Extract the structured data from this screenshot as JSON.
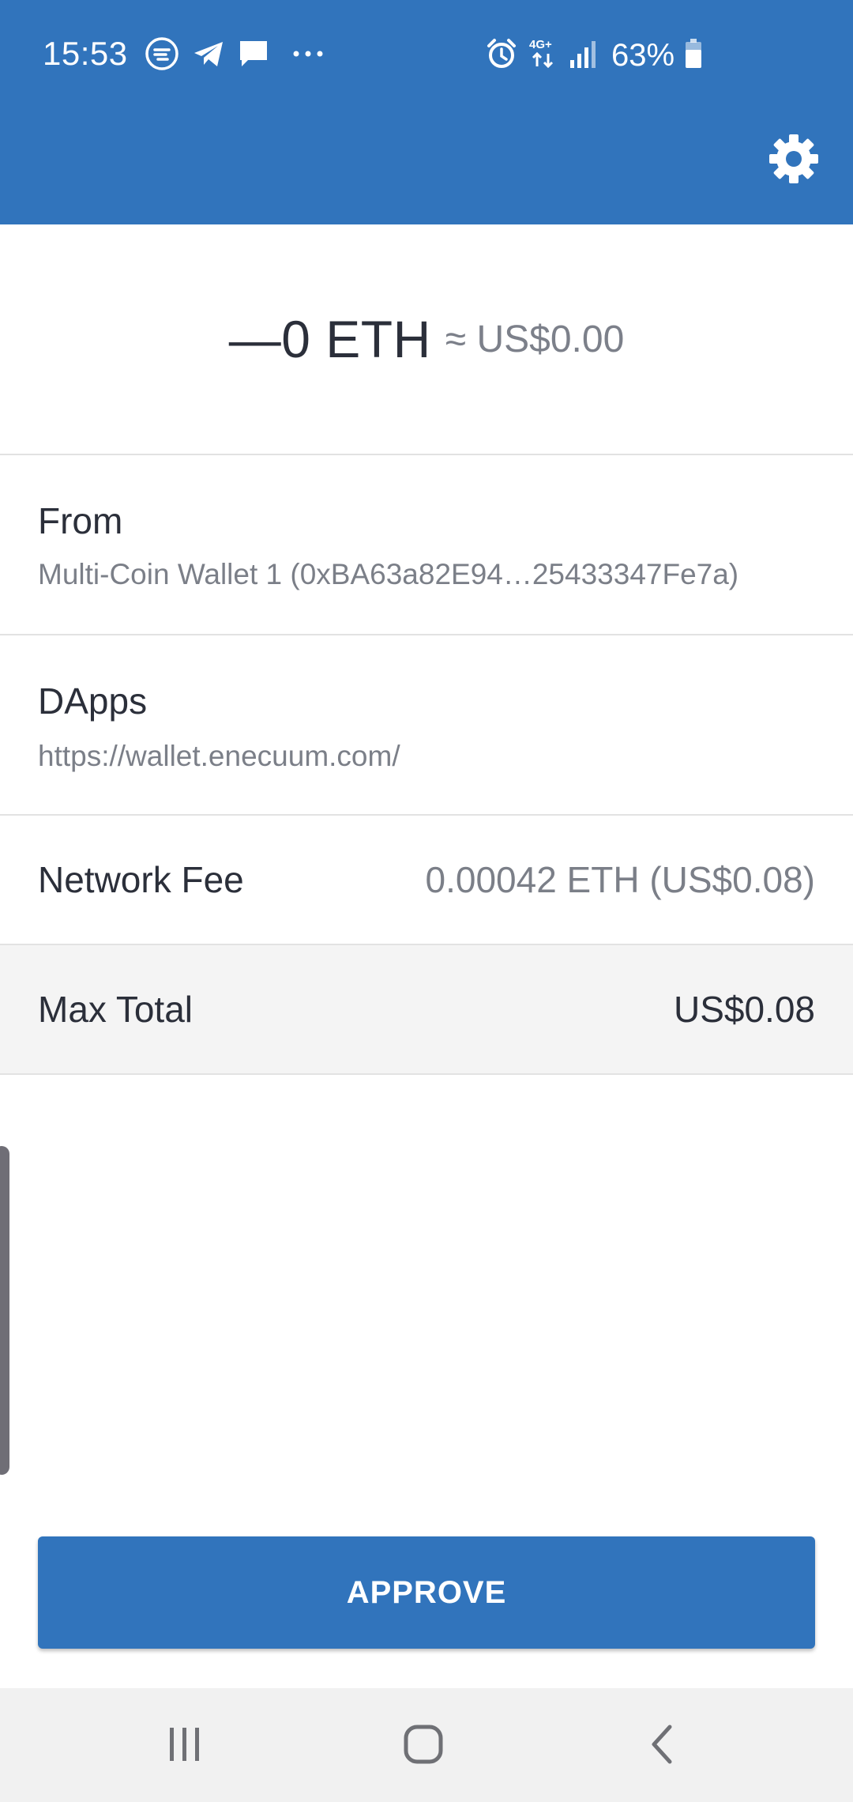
{
  "status_bar": {
    "time": "15:53",
    "battery": "63%",
    "network": "4G+",
    "notification_icons": [
      "sync-icon",
      "telegram-icon",
      "message-icon",
      "more-dots-icon"
    ],
    "system_icons": [
      "alarm-icon",
      "network-4g-icon",
      "signal-icon",
      "battery-icon"
    ]
  },
  "header": {
    "settings_icon": "gear-icon"
  },
  "transaction": {
    "amount": "—0 ETH",
    "amount_fiat": "≈ US$0.00"
  },
  "details": {
    "from_label": "From",
    "from_value": "Multi-Coin Wallet 1 (0xBA63a82E94…25433347Fe7a)",
    "dapps_label": "DApps",
    "dapps_value": "https://wallet.enecuum.com/",
    "fee_label": "Network Fee",
    "fee_value": "0.00042 ETH (US$0.08)",
    "total_label": "Max Total",
    "total_value": "US$0.08"
  },
  "actions": {
    "approve_label": "APPROVE"
  },
  "nav": {
    "items": [
      "recents-icon",
      "home-icon",
      "back-icon"
    ]
  },
  "colors": {
    "brand_blue": "#3174bc",
    "text_primary": "#2b2f3a",
    "text_secondary": "#7b7f88"
  }
}
